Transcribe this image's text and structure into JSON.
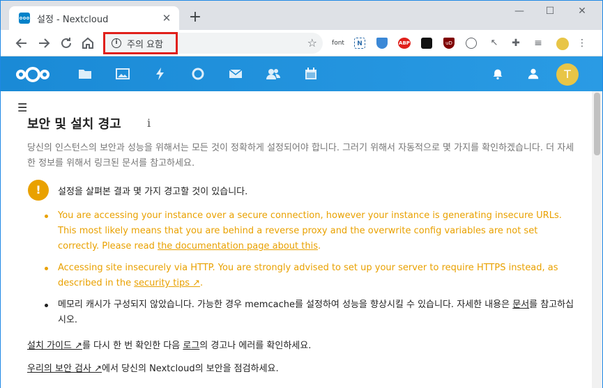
{
  "browser": {
    "tab_title": "설정 - Nextcloud",
    "tab_close": "✕",
    "new_tab": "+",
    "controls": {
      "minimize": "—",
      "maximize": "☐",
      "close": "✕"
    },
    "security_label": "주의 요함",
    "extensions": [
      "font",
      "N",
      "ABP",
      "uD"
    ]
  },
  "nc": {
    "avatar_letter": "T"
  },
  "page": {
    "title": "보안 및 설치 경고",
    "title_info": "i",
    "intro": "당신의 인스턴스의 보안과 성능을 위해서는 모든 것이 정확하게 설정되어야 합니다. 그러기 위해서 자동적으로 몇 가지를 확인하겠습니다. 더 자세한 정보를 위해서 링크된 문서를 참고하세요.",
    "warning_icon": "!",
    "warning_title": "설정을 살펴본 결과 몇 가지 경고할 것이 있습니다.",
    "items": [
      {
        "text": "You are accessing your instance over a secure connection, however your instance is generating insecure URLs. This most likely means that you are behind a reverse proxy and the overwrite config variables are not set correctly. Please read ",
        "link": "the documentation page about this",
        "after": "."
      },
      {
        "text": "Accessing site insecurely via HTTP. You are strongly advised to set up your server to require HTTPS instead, as described in the ",
        "link": "security tips ↗",
        "after": "."
      },
      {
        "text": "메모리 캐시가 구성되지 않았습니다. 가능한 경우 memcache를 설정하여 성능을 향상시킬 수 있습니다. 자세한 내용은 ",
        "link": "문서",
        "after": "를 참고하십시오."
      }
    ],
    "footer1": {
      "link1": "설치 가이드 ↗",
      "mid": "를 다시 한 번 확인한 다음 ",
      "link2": "로그",
      "after": "의 경고나 에러를 확인하세요."
    },
    "footer2": {
      "link": "우리의 보안 검사 ↗",
      "after": "에서 당신의 Nextcloud의 보안을 점검하세요."
    }
  }
}
